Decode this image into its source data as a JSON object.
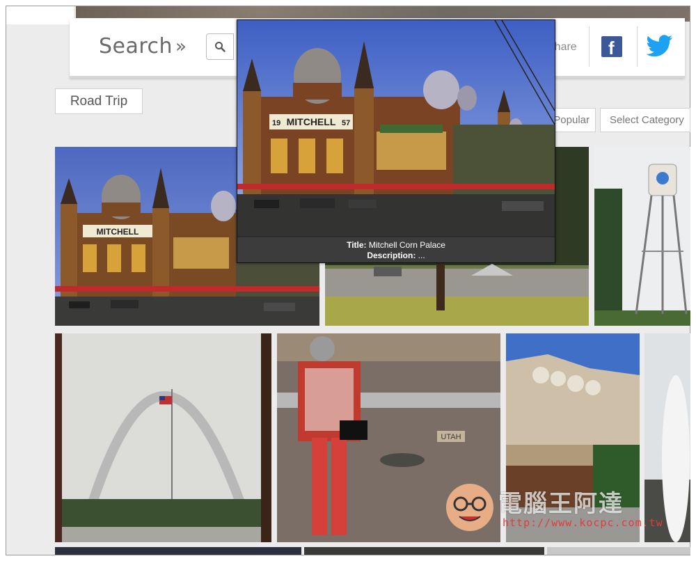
{
  "header": {
    "search_label": "Search",
    "search_arrows": "»",
    "share_label": "Share"
  },
  "category_tag": "Road Trip",
  "sort": {
    "popular_label": "Popular",
    "select_category_label": "Select Category"
  },
  "tooltip": {
    "title_label": "Title:",
    "title_value": "Mitchell Corn Palace",
    "description_label": "Description:",
    "description_value": "...",
    "sign_text": "MITCHELL",
    "sign_left": "19",
    "sign_right": "57"
  },
  "photos": [
    {
      "name": "Mitchell Corn Palace",
      "sign": "MITCHELL"
    },
    {
      "name": "Gravel road with tree"
    },
    {
      "name": "Water tower"
    },
    {
      "name": "Gateway Arch"
    },
    {
      "name": "Woman at state line",
      "marker": "UTAH"
    },
    {
      "name": "Mount Rushmore"
    },
    {
      "name": "Geyser"
    }
  ],
  "watermark": {
    "text": "電腦王阿達",
    "url": "http://www.kocpc.com.tw"
  },
  "colors": {
    "facebook": "#3b5998",
    "twitter": "#1da1f2",
    "watermark_url": "#e23b3b"
  }
}
